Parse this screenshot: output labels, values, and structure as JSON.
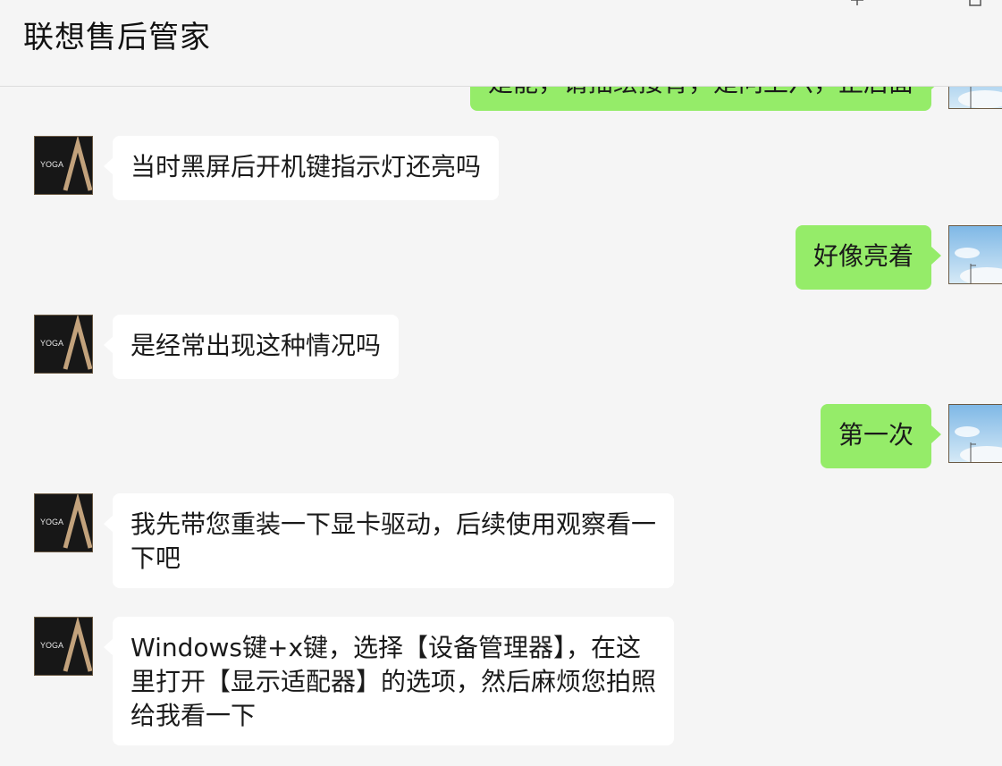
{
  "header": {
    "title": "联想售后管家"
  },
  "agent": {
    "name": "联想售后管家",
    "avatar_text": "YOGA",
    "avatar_icon": "yoga-logo-icon"
  },
  "user": {
    "avatar_icon": "sky-photo-icon"
  },
  "colors": {
    "background": "#f5f5f5",
    "incoming_bubble": "#ffffff",
    "outgoing_bubble": "#95ec69"
  },
  "messages": [
    {
      "side": "right",
      "text": "是能，请描绘接背，是问上六，正后面"
    },
    {
      "side": "left",
      "text": "当时黑屏后开机键指示灯还亮吗"
    },
    {
      "side": "right",
      "text": "好像亮着"
    },
    {
      "side": "left",
      "text": "是经常出现这种情况吗"
    },
    {
      "side": "right",
      "text": "第一次"
    },
    {
      "side": "left",
      "text": "我先带您重装一下显卡驱动，后续使用观察看一\n下吧"
    },
    {
      "side": "left",
      "text": "Windows键+x键，选择【设备管理器】，在这\n里打开【显示适配器】的选项，然后麻烦您拍照\n给我看一下"
    }
  ]
}
